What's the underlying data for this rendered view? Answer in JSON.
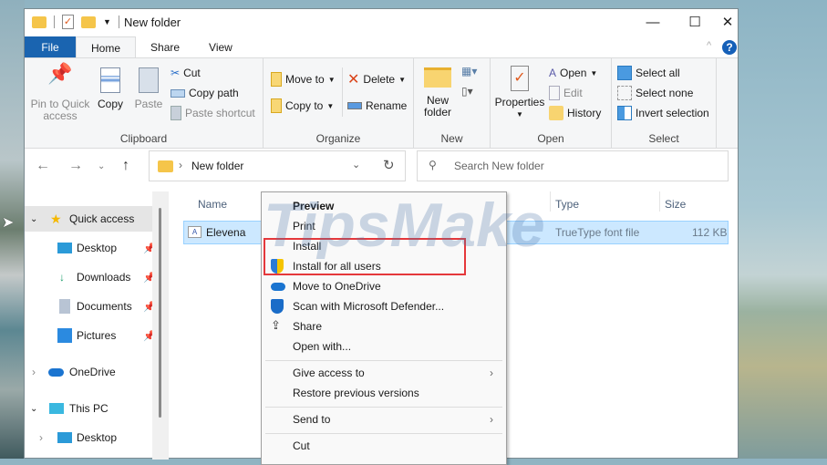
{
  "window": {
    "title": "New folder",
    "minimize": "—",
    "maximize": "☐",
    "close": "✕",
    "help": "?",
    "collapse": "^"
  },
  "tabs": [
    {
      "label": "File"
    },
    {
      "label": "Home"
    },
    {
      "label": "Share"
    },
    {
      "label": "View"
    }
  ],
  "ribbon": {
    "clipboard": {
      "label": "Clipboard",
      "pin": "Pin to Quick access",
      "copy": "Copy",
      "paste": "Paste",
      "cut": "Cut",
      "copy_path": "Copy path",
      "paste_shortcut": "Paste shortcut"
    },
    "organize": {
      "label": "Organize",
      "move_to": "Move to",
      "copy_to": "Copy to",
      "delete": "Delete",
      "rename": "Rename"
    },
    "new": {
      "label": "New",
      "new_folder": "New folder"
    },
    "open": {
      "label": "Open",
      "properties": "Properties",
      "open": "Open",
      "edit": "Edit",
      "history": "History"
    },
    "select": {
      "label": "Select",
      "select_all": "Select all",
      "select_none": "Select none",
      "invert": "Invert selection"
    }
  },
  "address": {
    "path": "New folder",
    "search_placeholder": "Search New folder"
  },
  "sidebar": {
    "items": [
      {
        "label": "Quick access"
      },
      {
        "label": "Desktop"
      },
      {
        "label": "Downloads"
      },
      {
        "label": "Documents"
      },
      {
        "label": "Pictures"
      },
      {
        "label": "OneDrive"
      },
      {
        "label": "This PC"
      },
      {
        "label": "Desktop"
      }
    ]
  },
  "columns": {
    "name": "Name",
    "type": "Type",
    "size": "Size"
  },
  "files": [
    {
      "name": "Elevena",
      "type": "TrueType font file",
      "size": "112 KB"
    }
  ],
  "context_menu": {
    "items": [
      {
        "label": "Preview"
      },
      {
        "label": "Print"
      },
      {
        "label": "Install"
      },
      {
        "label": "Install for all users"
      },
      {
        "label": "Move to OneDrive"
      },
      {
        "label": "Scan with Microsoft Defender..."
      },
      {
        "label": "Share"
      },
      {
        "label": "Open with..."
      },
      {
        "label": "Give access to"
      },
      {
        "label": "Restore previous versions"
      },
      {
        "label": "Send to"
      },
      {
        "label": "Cut"
      }
    ]
  },
  "watermark": "TipsMake",
  "colors": {
    "accent": "#1a64b0",
    "selection": "#cce8ff",
    "highlight_box": "#e5383b"
  }
}
